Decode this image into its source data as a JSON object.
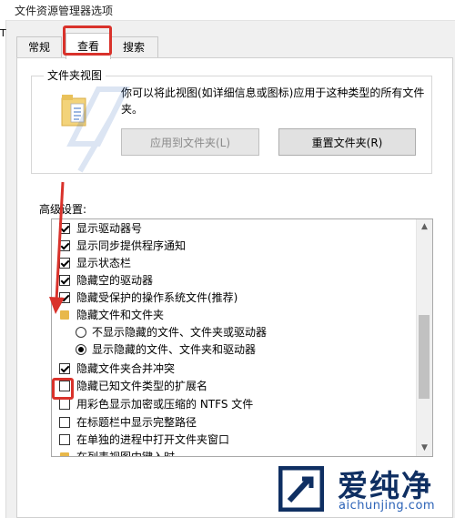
{
  "window": {
    "title": "文件资源管理器选项",
    "left_stub": "T"
  },
  "tabs": [
    {
      "label": "常规",
      "active": false
    },
    {
      "label": "查看",
      "active": true
    },
    {
      "label": "搜索",
      "active": false
    }
  ],
  "folder_view": {
    "title": "文件夹视图",
    "description": "你可以将此视图(如详细信息或图标)应用于这种类型的所有文件夹。",
    "apply_button": "应用到文件夹(L)",
    "reset_button": "重置文件夹(R)"
  },
  "advanced": {
    "label": "高级设置:",
    "items": [
      {
        "type": "checkbox",
        "checked": true,
        "label": "显示驱动器号"
      },
      {
        "type": "checkbox",
        "checked": true,
        "label": "显示同步提供程序通知"
      },
      {
        "type": "checkbox",
        "checked": true,
        "label": "显示状态栏"
      },
      {
        "type": "checkbox",
        "checked": true,
        "label": "隐藏空的驱动器"
      },
      {
        "type": "checkbox",
        "checked": true,
        "label": "隐藏受保护的操作系统文件(推荐)"
      },
      {
        "type": "folder",
        "label": "隐藏文件和文件夹"
      },
      {
        "type": "radio",
        "checked": false,
        "label": "不显示隐藏的文件、文件夹或驱动器"
      },
      {
        "type": "radio",
        "checked": true,
        "label": "显示隐藏的文件、文件夹和驱动器"
      },
      {
        "type": "checkbox",
        "checked": true,
        "label": "隐藏文件夹合并冲突"
      },
      {
        "type": "checkbox",
        "checked": false,
        "label": "隐藏已知文件类型的扩展名"
      },
      {
        "type": "checkbox",
        "checked": false,
        "label": "用彩色显示加密或压缩的 NTFS 文件"
      },
      {
        "type": "checkbox",
        "checked": false,
        "label": "在标题栏中显示完整路径"
      },
      {
        "type": "checkbox",
        "checked": false,
        "label": "在单独的进程中打开文件夹窗口"
      },
      {
        "type": "folder",
        "label": "在列表视图中键入时"
      }
    ]
  },
  "watermark": {
    "brand": "爱纯净",
    "url": "aichunjing.com"
  },
  "colors": {
    "highlight": "#d9322b",
    "brand_dark": "#0f2f62",
    "brand_url": "#2b62b7"
  }
}
